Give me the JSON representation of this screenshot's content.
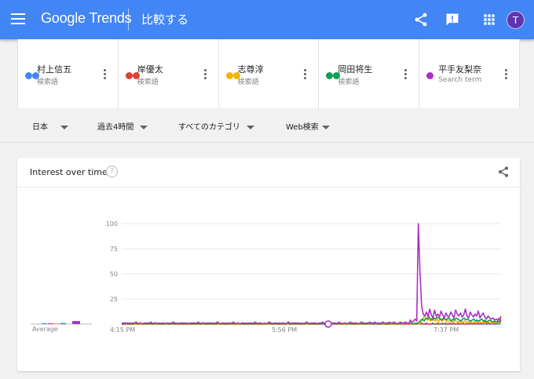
{
  "header": {
    "logo": "Google Trends",
    "title": "比較する",
    "avatar_letter": "T"
  },
  "terms": [
    {
      "name": "村上信五",
      "sub": "検索語",
      "color": "#4285f4"
    },
    {
      "name": "岸優太",
      "sub": "検索語",
      "color": "#db4437"
    },
    {
      "name": "志尊淳",
      "sub": "検索語",
      "color": "#f4b400"
    },
    {
      "name": "岡田将生",
      "sub": "検索語",
      "color": "#0f9d58"
    },
    {
      "name": "平手友梨奈",
      "sub": "Search term",
      "color": "#ab30c4"
    }
  ],
  "filters": {
    "region": "日本",
    "time": "過去4時間",
    "category": "すべてのカテゴリ",
    "search_type": "Web検索"
  },
  "card": {
    "title": "Interest over time",
    "help": "?"
  },
  "chart_data": {
    "type": "line",
    "ylim": [
      0,
      100
    ],
    "y_ticks": [
      "100",
      "75",
      "50",
      "25"
    ],
    "x_ticks": [
      "4:15 PM",
      "5:56 PM",
      "7:37 PM"
    ],
    "average_label": "Average",
    "averages": [
      {
        "name": "村上信五",
        "value": 0
      },
      {
        "name": "岸優太",
        "value": 0
      },
      {
        "name": "志尊淳",
        "value": 0
      },
      {
        "name": "岡田将生",
        "value": 1
      },
      {
        "name": "平手友梨奈",
        "value": 3
      }
    ],
    "series": [
      {
        "name": "村上信五",
        "color": "#4285f4",
        "values": [
          0,
          0,
          0,
          0,
          0,
          0,
          0,
          0,
          0,
          0,
          0,
          0,
          0,
          0,
          0,
          0,
          0,
          0,
          0,
          0,
          0,
          0,
          0,
          0,
          0,
          0,
          0,
          0,
          0,
          0,
          0,
          0,
          0,
          0,
          0,
          0,
          0,
          0,
          0,
          0,
          0,
          0,
          0,
          0,
          0,
          0,
          0,
          0,
          0,
          0,
          0,
          0,
          0,
          0,
          0,
          0,
          0,
          0,
          0,
          0,
          0,
          0,
          0,
          0,
          0,
          0,
          0,
          0,
          0,
          0,
          0,
          0,
          0,
          0,
          0,
          0,
          0,
          0,
          0,
          0,
          0,
          0,
          0,
          0,
          0,
          0,
          0,
          0,
          0,
          0,
          0,
          0,
          0,
          0,
          0,
          0,
          0,
          0,
          0,
          0,
          0,
          0,
          0,
          0,
          0,
          0,
          0,
          0,
          0,
          0,
          0,
          0,
          0,
          0,
          0,
          0,
          0,
          0,
          0,
          0,
          0,
          0,
          0,
          0,
          0,
          0,
          0,
          0,
          0,
          0,
          0,
          0,
          0,
          0,
          0,
          0,
          0,
          0,
          0,
          0,
          0,
          0,
          0,
          0,
          0,
          0,
          0,
          0,
          0,
          0,
          0,
          0,
          0,
          0,
          0,
          0,
          0,
          0,
          0,
          0,
          0,
          0,
          0,
          0,
          0,
          0,
          0,
          0,
          0,
          0,
          0,
          0,
          0,
          0,
          0,
          0,
          0,
          0,
          0,
          0,
          0,
          0,
          0,
          0,
          0,
          0,
          0,
          0,
          0,
          0,
          0,
          0,
          0,
          0,
          0,
          0,
          0,
          0,
          0,
          0,
          0,
          0,
          0,
          0,
          0,
          0,
          0,
          0,
          0,
          0,
          0,
          0,
          0,
          0,
          0,
          0,
          0,
          0,
          0,
          0,
          0,
          0,
          0,
          0,
          0,
          0,
          0,
          0,
          0,
          0,
          0,
          0,
          0,
          0,
          0,
          0,
          0,
          0,
          0,
          0,
          0,
          0,
          0,
          0,
          0,
          0,
          0,
          0,
          0,
          0
        ]
      },
      {
        "name": "岸優太",
        "color": "#db4437",
        "values": [
          0,
          0,
          0,
          0,
          0,
          0,
          0,
          0,
          0,
          0,
          0,
          0,
          0,
          0,
          0,
          0,
          0,
          0,
          0,
          0,
          0,
          0,
          0,
          0,
          0,
          0,
          0,
          0,
          0,
          0,
          0,
          0,
          0,
          0,
          0,
          0,
          0,
          0,
          0,
          0,
          0,
          0,
          0,
          0,
          0,
          0,
          0,
          0,
          0,
          0,
          0,
          0,
          0,
          0,
          0,
          0,
          0,
          0,
          0,
          0,
          0,
          0,
          0,
          0,
          0,
          0,
          0,
          0,
          0,
          0,
          0,
          0,
          0,
          0,
          0,
          0,
          0,
          0,
          0,
          0,
          0,
          0,
          0,
          0,
          0,
          0,
          0,
          0,
          0,
          0,
          0,
          0,
          0,
          0,
          0,
          0,
          0,
          0,
          0,
          0,
          0,
          0,
          0,
          0,
          0,
          0,
          0,
          0,
          0,
          0,
          0,
          0,
          0,
          0,
          0,
          0,
          0,
          0,
          0,
          0,
          0,
          0,
          0,
          0,
          0,
          0,
          0,
          0,
          0,
          0,
          0,
          0,
          0,
          0,
          0,
          0,
          0,
          0,
          0,
          0,
          0,
          0,
          0,
          0,
          0,
          0,
          0,
          0,
          0,
          0,
          0,
          0,
          0,
          0,
          0,
          0,
          0,
          0,
          0,
          0,
          0,
          0,
          0,
          0,
          0,
          0,
          0,
          0,
          0,
          0,
          0,
          0,
          0,
          0,
          0,
          0,
          0,
          0,
          0,
          0,
          0,
          0,
          0,
          0,
          0,
          0,
          1,
          0,
          0,
          1,
          0,
          0,
          1,
          0,
          0,
          0,
          1,
          0,
          0,
          1,
          0,
          0,
          1,
          0,
          1,
          0,
          0,
          1,
          0,
          1,
          0,
          0,
          1,
          0,
          0,
          1,
          0,
          0,
          2,
          0,
          1,
          0,
          1,
          0,
          2,
          0,
          1,
          0,
          1,
          3,
          0,
          1,
          0,
          2,
          1,
          0,
          1,
          1,
          3,
          8
        ]
      },
      {
        "name": "志尊淳",
        "color": "#f4b400",
        "values": [
          0,
          0,
          0,
          0,
          0,
          0,
          0,
          0,
          0,
          0,
          0,
          0,
          0,
          0,
          0,
          0,
          0,
          0,
          0,
          0,
          0,
          0,
          0,
          0,
          0,
          0,
          0,
          0,
          0,
          0,
          0,
          0,
          0,
          0,
          0,
          0,
          0,
          0,
          0,
          0,
          0,
          0,
          0,
          0,
          0,
          0,
          0,
          0,
          0,
          0,
          0,
          0,
          0,
          0,
          0,
          0,
          0,
          0,
          0,
          0,
          0,
          0,
          0,
          0,
          0,
          0,
          0,
          0,
          0,
          0,
          0,
          0,
          0,
          0,
          0,
          0,
          0,
          0,
          0,
          0,
          0,
          0,
          0,
          0,
          0,
          0,
          0,
          0,
          0,
          0,
          0,
          0,
          0,
          0,
          0,
          0,
          0,
          0,
          0,
          0,
          0,
          0,
          0,
          0,
          0,
          0,
          0,
          0,
          0,
          0,
          0,
          0,
          0,
          0,
          0,
          0,
          0,
          0,
          0,
          0,
          0,
          0,
          0,
          0,
          0,
          0,
          0,
          0,
          0,
          0,
          0,
          0,
          0,
          0,
          0,
          0,
          0,
          0,
          0,
          0,
          0,
          0,
          0,
          0,
          0,
          0,
          0,
          0,
          0,
          0,
          0,
          0,
          0,
          0,
          0,
          0,
          0,
          0,
          0,
          0,
          0,
          0,
          0,
          0,
          0,
          0,
          0,
          0,
          0,
          0,
          0,
          0,
          0,
          0,
          0,
          0,
          0,
          0,
          0,
          0,
          0,
          0,
          0,
          0,
          0,
          0,
          0,
          3,
          5,
          8,
          6,
          4,
          5,
          3,
          6,
          4,
          3,
          5,
          2,
          6,
          3,
          4,
          5,
          3,
          2,
          4,
          3,
          2,
          4,
          3,
          2,
          3,
          1,
          2,
          3,
          2,
          1,
          2,
          3,
          1,
          2,
          1,
          2,
          3,
          2,
          1,
          2,
          1,
          2,
          3,
          1,
          2,
          1,
          2,
          1,
          2,
          1,
          0
        ]
      },
      {
        "name": "岡田将生",
        "color": "#0f9d58",
        "values": [
          1,
          1,
          0,
          1,
          1,
          0,
          1,
          0,
          1,
          1,
          0,
          1,
          1,
          0,
          1,
          0,
          1,
          1,
          0,
          1,
          0,
          1,
          1,
          0,
          1,
          0,
          1,
          0,
          1,
          1,
          0,
          1,
          0,
          1,
          1,
          0,
          1,
          0,
          1,
          1,
          0,
          1,
          0,
          1,
          1,
          0,
          1,
          0,
          1,
          0,
          1,
          1,
          0,
          1,
          0,
          1,
          1,
          0,
          1,
          0,
          1,
          1,
          0,
          1,
          0,
          1,
          0,
          1,
          1,
          0,
          1,
          0,
          1,
          1,
          0,
          1,
          0,
          1,
          0,
          1,
          1,
          0,
          1,
          0,
          1,
          1,
          0,
          1,
          0,
          1,
          0,
          1,
          1,
          0,
          1,
          0,
          1,
          1,
          0,
          1,
          0,
          1,
          0,
          1,
          1,
          0,
          1,
          0,
          1,
          1,
          0,
          1,
          0,
          1,
          0,
          1,
          1,
          0,
          1,
          0,
          1,
          1,
          0,
          1,
          0,
          1,
          0,
          1,
          1,
          0,
          1,
          0,
          1,
          1,
          0,
          1,
          0,
          1,
          0,
          1,
          1,
          0,
          1,
          0,
          1,
          1,
          0,
          1,
          0,
          1,
          0,
          1,
          1,
          0,
          1,
          0,
          1,
          1,
          0,
          1,
          0,
          1,
          0,
          1,
          1,
          0,
          1,
          0,
          1,
          1,
          0,
          1,
          0,
          1,
          0,
          1,
          1,
          0,
          1,
          0,
          1,
          1,
          0,
          1,
          0,
          1,
          2,
          4,
          5,
          3,
          6,
          5,
          7,
          5,
          4,
          6,
          5,
          7,
          6,
          5,
          4,
          6,
          5,
          4,
          6,
          5,
          3,
          5,
          4,
          6,
          5,
          4,
          3,
          5,
          6,
          4,
          5,
          4,
          3,
          4,
          5,
          3,
          4,
          3,
          4,
          5,
          3,
          4,
          2,
          3,
          4,
          3,
          2,
          3,
          2,
          3,
          2,
          2
        ]
      },
      {
        "name": "平手友梨奈",
        "color": "#ab30c4",
        "values": [
          1,
          0,
          1,
          1,
          0,
          1,
          0,
          1,
          1,
          2,
          0,
          1,
          1,
          0,
          1,
          1,
          0,
          1,
          2,
          0,
          1,
          1,
          0,
          1,
          0,
          1,
          1,
          0,
          1,
          0,
          1,
          1,
          2,
          0,
          1,
          0,
          1,
          1,
          0,
          1,
          1,
          0,
          1,
          0,
          1,
          1,
          0,
          2,
          1,
          0,
          1,
          1,
          0,
          1,
          1,
          0,
          1,
          0,
          1,
          2,
          1,
          0,
          1,
          1,
          0,
          1,
          0,
          1,
          1,
          2,
          0,
          1,
          1,
          0,
          1,
          1,
          0,
          1,
          0,
          1,
          1,
          0,
          2,
          1,
          0,
          1,
          1,
          0,
          1,
          0,
          1,
          2,
          1,
          0,
          1,
          1,
          0,
          1,
          0,
          1,
          1,
          0,
          1,
          2,
          0,
          1,
          1,
          0,
          1,
          1,
          0,
          1,
          0,
          1,
          2,
          1,
          0,
          1,
          1,
          0,
          1,
          0,
          1,
          1,
          2,
          0,
          1,
          1,
          0,
          1,
          1,
          0,
          1,
          0,
          2,
          1,
          0,
          1,
          1,
          0,
          1,
          2,
          1,
          0,
          1,
          1,
          0,
          1,
          2,
          1,
          0,
          1,
          1,
          2,
          1,
          0,
          2,
          1,
          1,
          0,
          1,
          2,
          1,
          1,
          0,
          2,
          1,
          1,
          2,
          1,
          0,
          1,
          2,
          1,
          1,
          2,
          1,
          0,
          4,
          2,
          3,
          5,
          3,
          100,
          52,
          18,
          10,
          8,
          12,
          7,
          15,
          9,
          6,
          14,
          8,
          10,
          7,
          13,
          9,
          6,
          11,
          8,
          7,
          12,
          9,
          6,
          14,
          10,
          8,
          11,
          7,
          9,
          15,
          8,
          6,
          12,
          9,
          7,
          10,
          8,
          13,
          6,
          9,
          11,
          7,
          5,
          8,
          6,
          5,
          6,
          4,
          5,
          4,
          6,
          3
        ]
      }
    ]
  }
}
